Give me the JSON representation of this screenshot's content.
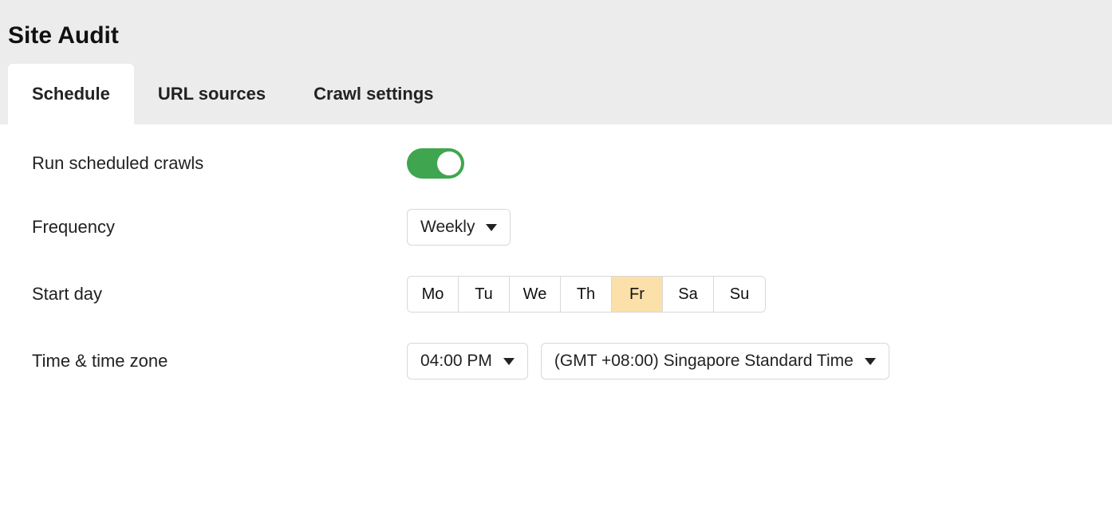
{
  "pageTitle": "Site Audit",
  "tabs": {
    "schedule": "Schedule",
    "urlSources": "URL sources",
    "crawlSettings": "Crawl settings"
  },
  "labels": {
    "runScheduled": "Run scheduled crawls",
    "frequency": "Frequency",
    "startDay": "Start day",
    "timeZone": "Time & time zone"
  },
  "frequency": {
    "selected": "Weekly"
  },
  "days": {
    "mo": "Mo",
    "tu": "Tu",
    "we": "We",
    "th": "Th",
    "fr": "Fr",
    "sa": "Sa",
    "su": "Su",
    "selected": "fr"
  },
  "time": {
    "selected": "04:00 PM"
  },
  "timezone": {
    "selected": "(GMT +08:00) Singapore Standard Time"
  },
  "toggle": {
    "runScheduled": true
  }
}
